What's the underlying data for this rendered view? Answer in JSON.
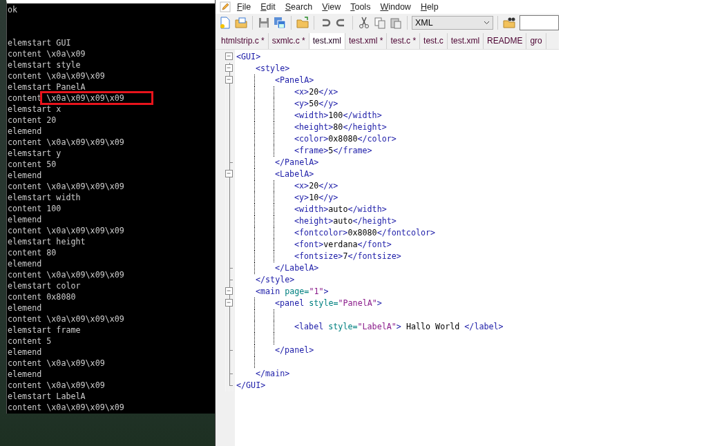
{
  "console": {
    "lines": [
      {
        "kind": "text",
        "text": "ok",
        "highlighted": false
      },
      {
        "kind": "blank"
      },
      {
        "kind": "blank"
      },
      {
        "kind": "text",
        "text": "elemstart GUI",
        "highlighted": false
      },
      {
        "kind": "text",
        "text": "content \\x0a\\x09",
        "highlighted": false
      },
      {
        "kind": "text",
        "text": "elemstart style",
        "highlighted": false
      },
      {
        "kind": "text",
        "text": "content \\x0a\\x09\\x09",
        "highlighted": false
      },
      {
        "kind": "text",
        "text": "elemstart PanelA",
        "highlighted": false
      },
      {
        "kind": "text",
        "text": "content \\x0a\\x09\\x09\\x09",
        "highlighted": true
      },
      {
        "kind": "text",
        "text": "elemstart x",
        "highlighted": false
      },
      {
        "kind": "text",
        "text": "content 20",
        "highlighted": false
      },
      {
        "kind": "text",
        "text": "elemend",
        "highlighted": false
      },
      {
        "kind": "text",
        "text": "content \\x0a\\x09\\x09\\x09",
        "highlighted": false
      },
      {
        "kind": "text",
        "text": "elemstart y",
        "highlighted": false
      },
      {
        "kind": "text",
        "text": "content 50",
        "highlighted": false
      },
      {
        "kind": "text",
        "text": "elemend",
        "highlighted": false
      },
      {
        "kind": "text",
        "text": "content \\x0a\\x09\\x09\\x09",
        "highlighted": false
      },
      {
        "kind": "text",
        "text": "elemstart width",
        "highlighted": false
      },
      {
        "kind": "text",
        "text": "content 100",
        "highlighted": false
      },
      {
        "kind": "text",
        "text": "elemend",
        "highlighted": false
      },
      {
        "kind": "text",
        "text": "content \\x0a\\x09\\x09\\x09",
        "highlighted": false
      },
      {
        "kind": "text",
        "text": "elemstart height",
        "highlighted": false
      },
      {
        "kind": "text",
        "text": "content 80",
        "highlighted": false
      },
      {
        "kind": "text",
        "text": "elemend",
        "highlighted": false
      },
      {
        "kind": "text",
        "text": "content \\x0a\\x09\\x09\\x09",
        "highlighted": false
      },
      {
        "kind": "text",
        "text": "elemstart color",
        "highlighted": false
      },
      {
        "kind": "text",
        "text": "content 0x8080",
        "highlighted": false
      },
      {
        "kind": "text",
        "text": "elemend",
        "highlighted": false
      },
      {
        "kind": "text",
        "text": "content \\x0a\\x09\\x09\\x09",
        "highlighted": false
      },
      {
        "kind": "text",
        "text": "elemstart frame",
        "highlighted": false
      },
      {
        "kind": "text",
        "text": "content 5",
        "highlighted": false
      },
      {
        "kind": "text",
        "text": "elemend",
        "highlighted": false
      },
      {
        "kind": "text",
        "text": "content \\x0a\\x09\\x09",
        "highlighted": false
      },
      {
        "kind": "text",
        "text": "elemend",
        "highlighted": false
      },
      {
        "kind": "text",
        "text": "content \\x0a\\x09\\x09",
        "highlighted": false
      },
      {
        "kind": "text",
        "text": "elemstart LabelA",
        "highlighted": false
      },
      {
        "kind": "text",
        "text": "content \\x0a\\x09\\x09\\x09",
        "highlighted": false
      }
    ]
  },
  "editor": {
    "menu": [
      "File",
      "Edit",
      "Search",
      "View",
      "Tools",
      "Window",
      "Help"
    ],
    "toolbar": {
      "language": "XML"
    },
    "tabs": [
      {
        "label": "htmlstrip.c *",
        "selected": false
      },
      {
        "label": "sxmlc.c *",
        "selected": false
      },
      {
        "label": "test.xml",
        "selected": true
      },
      {
        "label": "test.xml *",
        "selected": false
      },
      {
        "label": "test.c *",
        "selected": false
      },
      {
        "label": "test.c",
        "selected": false
      },
      {
        "label": "test.xml",
        "selected": false
      },
      {
        "label": "README",
        "selected": false
      },
      {
        "label": "gro",
        "selected": false
      }
    ],
    "code": [
      {
        "kind": "element",
        "expanded": true,
        "open": [
          {
            "kind": "tag",
            "text": "<GUI>"
          }
        ],
        "close": [
          {
            "kind": "tag",
            "text": "</GUI>"
          }
        ],
        "children": [
          {
            "kind": "element",
            "expanded": true,
            "open": [
              {
                "kind": "tag",
                "text": "<style>"
              }
            ],
            "close": [
              {
                "kind": "tag",
                "text": "</style>"
              }
            ],
            "children": [
              {
                "kind": "element",
                "expanded": true,
                "open": [
                  {
                    "kind": "tag",
                    "text": "<PanelA>"
                  }
                ],
                "close": [
                  {
                    "kind": "tag",
                    "text": "</PanelA>"
                  }
                ],
                "children": [
                  {
                    "kind": "line",
                    "tokens": [
                      {
                        "kind": "tag",
                        "text": "<x>"
                      },
                      {
                        "kind": "text",
                        "text": "20"
                      },
                      {
                        "kind": "tag",
                        "text": "</x>"
                      }
                    ]
                  },
                  {
                    "kind": "line",
                    "tokens": [
                      {
                        "kind": "tag",
                        "text": "<y>"
                      },
                      {
                        "kind": "text",
                        "text": "50"
                      },
                      {
                        "kind": "tag",
                        "text": "</y>"
                      }
                    ]
                  },
                  {
                    "kind": "line",
                    "tokens": [
                      {
                        "kind": "tag",
                        "text": "<width>"
                      },
                      {
                        "kind": "text",
                        "text": "100"
                      },
                      {
                        "kind": "tag",
                        "text": "</width>"
                      }
                    ]
                  },
                  {
                    "kind": "line",
                    "tokens": [
                      {
                        "kind": "tag",
                        "text": "<height>"
                      },
                      {
                        "kind": "text",
                        "text": "80"
                      },
                      {
                        "kind": "tag",
                        "text": "</height>"
                      }
                    ]
                  },
                  {
                    "kind": "line",
                    "tokens": [
                      {
                        "kind": "tag",
                        "text": "<color>"
                      },
                      {
                        "kind": "text",
                        "text": "0x8080"
                      },
                      {
                        "kind": "tag",
                        "text": "</color>"
                      }
                    ]
                  },
                  {
                    "kind": "line",
                    "tokens": [
                      {
                        "kind": "tag",
                        "text": "<frame>"
                      },
                      {
                        "kind": "text",
                        "text": "5"
                      },
                      {
                        "kind": "tag",
                        "text": "</frame>"
                      }
                    ]
                  }
                ]
              },
              {
                "kind": "element",
                "expanded": true,
                "open": [
                  {
                    "kind": "tag",
                    "text": "<LabelA>"
                  }
                ],
                "close": [
                  {
                    "kind": "tag",
                    "text": "</LabelA>"
                  }
                ],
                "children": [
                  {
                    "kind": "line",
                    "tokens": [
                      {
                        "kind": "tag",
                        "text": "<x>"
                      },
                      {
                        "kind": "text",
                        "text": "20"
                      },
                      {
                        "kind": "tag",
                        "text": "</x>"
                      }
                    ]
                  },
                  {
                    "kind": "line",
                    "tokens": [
                      {
                        "kind": "tag",
                        "text": "<y>"
                      },
                      {
                        "kind": "text",
                        "text": "10"
                      },
                      {
                        "kind": "tag",
                        "text": "</y>"
                      }
                    ]
                  },
                  {
                    "kind": "line",
                    "tokens": [
                      {
                        "kind": "tag",
                        "text": "<width>"
                      },
                      {
                        "kind": "text",
                        "text": "auto"
                      },
                      {
                        "kind": "tag",
                        "text": "</width>"
                      }
                    ]
                  },
                  {
                    "kind": "line",
                    "tokens": [
                      {
                        "kind": "tag",
                        "text": "<height>"
                      },
                      {
                        "kind": "text",
                        "text": "auto"
                      },
                      {
                        "kind": "tag",
                        "text": "</height>"
                      }
                    ]
                  },
                  {
                    "kind": "line",
                    "tokens": [
                      {
                        "kind": "tag",
                        "text": "<fontcolor>"
                      },
                      {
                        "kind": "text",
                        "text": "0x8080"
                      },
                      {
                        "kind": "tag",
                        "text": "</fontcolor>"
                      }
                    ]
                  },
                  {
                    "kind": "line",
                    "tokens": [
                      {
                        "kind": "tag",
                        "text": "<font>"
                      },
                      {
                        "kind": "text",
                        "text": "verdana"
                      },
                      {
                        "kind": "tag",
                        "text": "</font>"
                      }
                    ]
                  },
                  {
                    "kind": "line",
                    "tokens": [
                      {
                        "kind": "tag",
                        "text": "<fontsize>"
                      },
                      {
                        "kind": "text",
                        "text": "7"
                      },
                      {
                        "kind": "tag",
                        "text": "</fontsize>"
                      }
                    ]
                  }
                ]
              }
            ]
          },
          {
            "kind": "element",
            "expanded": true,
            "open": [
              {
                "kind": "tag",
                "text": "<main"
              },
              {
                "kind": "attr",
                "text": " page="
              },
              {
                "kind": "value",
                "text": "\"1\""
              },
              {
                "kind": "tag",
                "text": ">"
              }
            ],
            "close": [
              {
                "kind": "tag",
                "text": "</main>"
              }
            ],
            "children": [
              {
                "kind": "element",
                "expanded": true,
                "open": [
                  {
                    "kind": "tag",
                    "text": "<panel"
                  },
                  {
                    "kind": "attr",
                    "text": " style="
                  },
                  {
                    "kind": "value",
                    "text": "\"PanelA\""
                  },
                  {
                    "kind": "tag",
                    "text": ">"
                  }
                ],
                "close": [
                  {
                    "kind": "tag",
                    "text": "</panel>"
                  }
                ],
                "children": [
                  {
                    "kind": "blank"
                  },
                  {
                    "kind": "line",
                    "tokens": [
                      {
                        "kind": "tag",
                        "text": "<label"
                      },
                      {
                        "kind": "attr",
                        "text": " style="
                      },
                      {
                        "kind": "value",
                        "text": "\"LabelA\""
                      },
                      {
                        "kind": "tag",
                        "text": ">"
                      },
                      {
                        "kind": "text",
                        "text": " Hallo World "
                      },
                      {
                        "kind": "tag",
                        "text": "</label>"
                      }
                    ]
                  },
                  {
                    "kind": "blank"
                  }
                ]
              },
              {
                "kind": "blank"
              }
            ]
          }
        ]
      }
    ]
  }
}
